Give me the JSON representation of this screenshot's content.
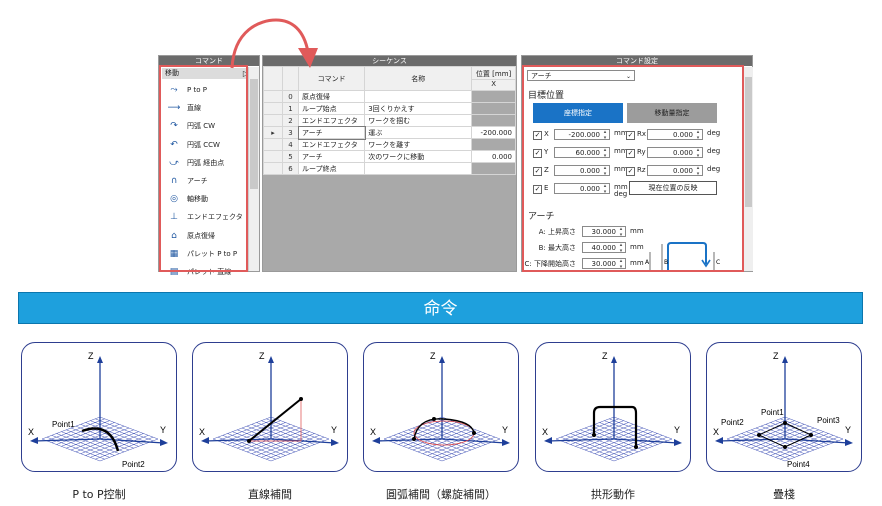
{
  "command_panel": {
    "title": "コマンド",
    "category": "移動",
    "items": [
      "P to P",
      "直線",
      "円弧 CW",
      "円弧 CCW",
      "円弧 経由点",
      "アーチ",
      "軸移動",
      "エンドエフェクタ",
      "原点復帰",
      "パレット P to P",
      "パレット 直線"
    ],
    "icons": [
      "ptp-icon",
      "line-icon",
      "arc-cw-icon",
      "arc-ccw-icon",
      "arc-via-icon",
      "arch-icon",
      "axis-icon",
      "effector-icon",
      "home-icon",
      "pallet-ptp-icon",
      "pallet-line-icon"
    ]
  },
  "sequence_panel": {
    "title": "シーケンス",
    "headers": {
      "command": "コマンド",
      "name": "名称",
      "position": "位置 [mm]",
      "x": "X"
    },
    "rows": [
      {
        "n": "0",
        "cmd": "原点復帰",
        "name": "",
        "x": "",
        "gray": true
      },
      {
        "n": "1",
        "cmd": "ループ始点",
        "name": "3回くりかえす",
        "x": "",
        "gray": true
      },
      {
        "n": "2",
        "cmd": "エンドエフェクタ",
        "name": "ワークを掴む",
        "x": "",
        "gray": true
      },
      {
        "n": "3",
        "cmd": "アーチ",
        "name": "運ぶ",
        "x": "-200.000",
        "gray": false
      },
      {
        "n": "4",
        "cmd": "エンドエフェクタ",
        "name": "ワークを離す",
        "x": "",
        "gray": true
      },
      {
        "n": "5",
        "cmd": "アーチ",
        "name": "次のワークに移動",
        "x": "0.000",
        "gray": false
      },
      {
        "n": "6",
        "cmd": "ループ終点",
        "name": "",
        "x": "",
        "gray": true
      }
    ]
  },
  "settings_panel": {
    "title": "コマンド設定",
    "select": "アーチ",
    "target_heading": "目標位置",
    "tab_coord": "座標指定",
    "tab_move": "移動量指定",
    "axes_left": [
      {
        "label": "X",
        "value": "-200.000",
        "unit": "mm"
      },
      {
        "label": "Y",
        "value": "60.000",
        "unit": "mm"
      },
      {
        "label": "Z",
        "value": "0.000",
        "unit": "mm"
      },
      {
        "label": "E",
        "value": "0.000",
        "unit": "mm\ndeg"
      }
    ],
    "axes_right": [
      {
        "label": "Rx",
        "value": "0.000",
        "unit": "deg"
      },
      {
        "label": "Ry",
        "value": "0.000",
        "unit": "deg"
      },
      {
        "label": "Rz",
        "value": "0.000",
        "unit": "deg"
      }
    ],
    "reflect_button": "現在位置の反映",
    "arch_heading": "アーチ",
    "arch_params": [
      {
        "label": "A: 上昇高さ",
        "value": "30.000",
        "unit": "mm"
      },
      {
        "label": "B: 最大高さ",
        "value": "40.000",
        "unit": "mm"
      },
      {
        "label": "C: 下降開始高さ",
        "value": "30.000",
        "unit": "mm"
      }
    ],
    "diagram_labels": [
      "A",
      "B",
      "C"
    ]
  },
  "banner": "命令",
  "cards": [
    {
      "caption": "P to P控制",
      "labels": {
        "z": "Z",
        "x": "X",
        "y": "Y",
        "p1": "Point1",
        "p2": "Point2"
      }
    },
    {
      "caption": "直線補間",
      "labels": {
        "z": "Z",
        "x": "X",
        "y": "Y"
      }
    },
    {
      "caption": "圓弧補間（螺旋補間）",
      "labels": {
        "z": "Z",
        "x": "X",
        "y": "Y"
      }
    },
    {
      "caption": "拱形動作",
      "labels": {
        "z": "Z",
        "x": "X",
        "y": "Y"
      }
    },
    {
      "caption": "疊棧",
      "labels": {
        "z": "Z",
        "x": "X",
        "y": "Y",
        "p1": "Point1",
        "p2": "Point2",
        "p3": "Point3",
        "p4": "Point4"
      }
    }
  ],
  "colors": {
    "accent_red": "#e05a5a",
    "banner_blue": "#1ea0dd",
    "tab_blue": "#1a73c6",
    "axis_blue": "#1e3f9a",
    "grid": "#3d4fb5"
  }
}
